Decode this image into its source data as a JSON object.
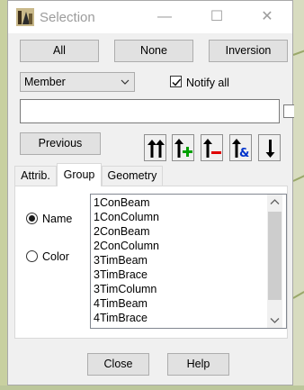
{
  "window": {
    "title": "Selection",
    "icons": {
      "app": "selection-app-icon",
      "minimize": "minimize-icon",
      "maximize": "maximize-icon",
      "close": "close-icon"
    }
  },
  "top_buttons": {
    "all": "All",
    "none": "None",
    "inversion": "Inversion"
  },
  "filter": {
    "type_selected": "Member",
    "notify_all_label": "Notify all",
    "notify_all_checked": true,
    "search_value": ""
  },
  "previous_button": "Previous",
  "tool_icons": [
    "select-up-double-icon",
    "add-selection-icon",
    "remove-selection-icon",
    "and-selection-icon",
    "select-down-icon"
  ],
  "tabs": [
    "Attrib.",
    "Group",
    "Geometry"
  ],
  "active_tab": "Group",
  "group_panel": {
    "radio_name": "Name",
    "radio_color": "Color",
    "selected_radio": "Name",
    "items": [
      "1ConBeam",
      "1ConColumn",
      "2ConBeam",
      "2ConColumn",
      "3TimBeam",
      "3TimBrace",
      "3TimColumn",
      "4TimBeam",
      "4TimBrace"
    ]
  },
  "bottom_buttons": {
    "close": "Close",
    "help": "Help"
  },
  "colors": {
    "add": "#00a000",
    "remove": "#e00000",
    "and": "#0033cc"
  }
}
